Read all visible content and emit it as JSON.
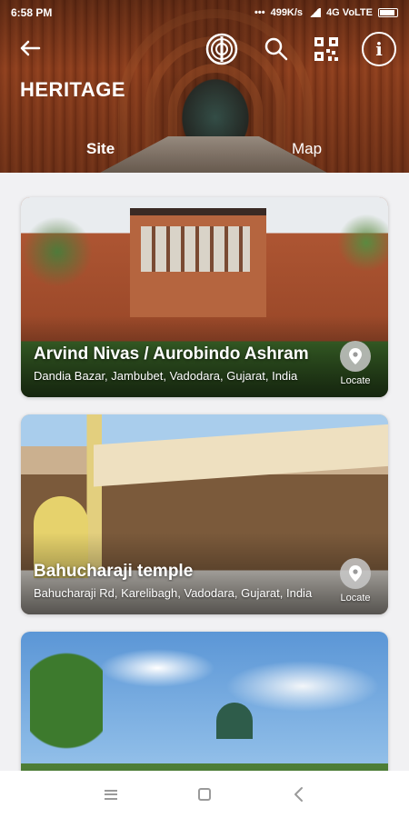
{
  "status_bar": {
    "time": "6:58 PM",
    "net_speed": "499K/s",
    "network": "4G VoLTE"
  },
  "header": {
    "title": "HERITAGE",
    "tabs": [
      {
        "label": "Site",
        "active": true
      },
      {
        "label": "Map",
        "active": false
      }
    ],
    "icons": [
      "back-arrow-icon",
      "audio-guide-icon",
      "search-icon",
      "qr-code-icon",
      "info-icon"
    ]
  },
  "sites": [
    {
      "title": "Arvind Nivas / Aurobindo Ashram",
      "address": "Dandia Bazar, Jambubet, Vadodara, Gujarat, India",
      "action": "Locate"
    },
    {
      "title": "Bahucharaji temple",
      "address": "Bahucharaji Rd, Karelibagh, Vadodara, Gujarat, India",
      "action": "Locate"
    },
    {
      "title": "",
      "address": "",
      "action": ""
    }
  ],
  "colors": {
    "header_brick": "#8a3c1d",
    "background": "#f1f1f3",
    "text_on_image": "#ffffff"
  }
}
